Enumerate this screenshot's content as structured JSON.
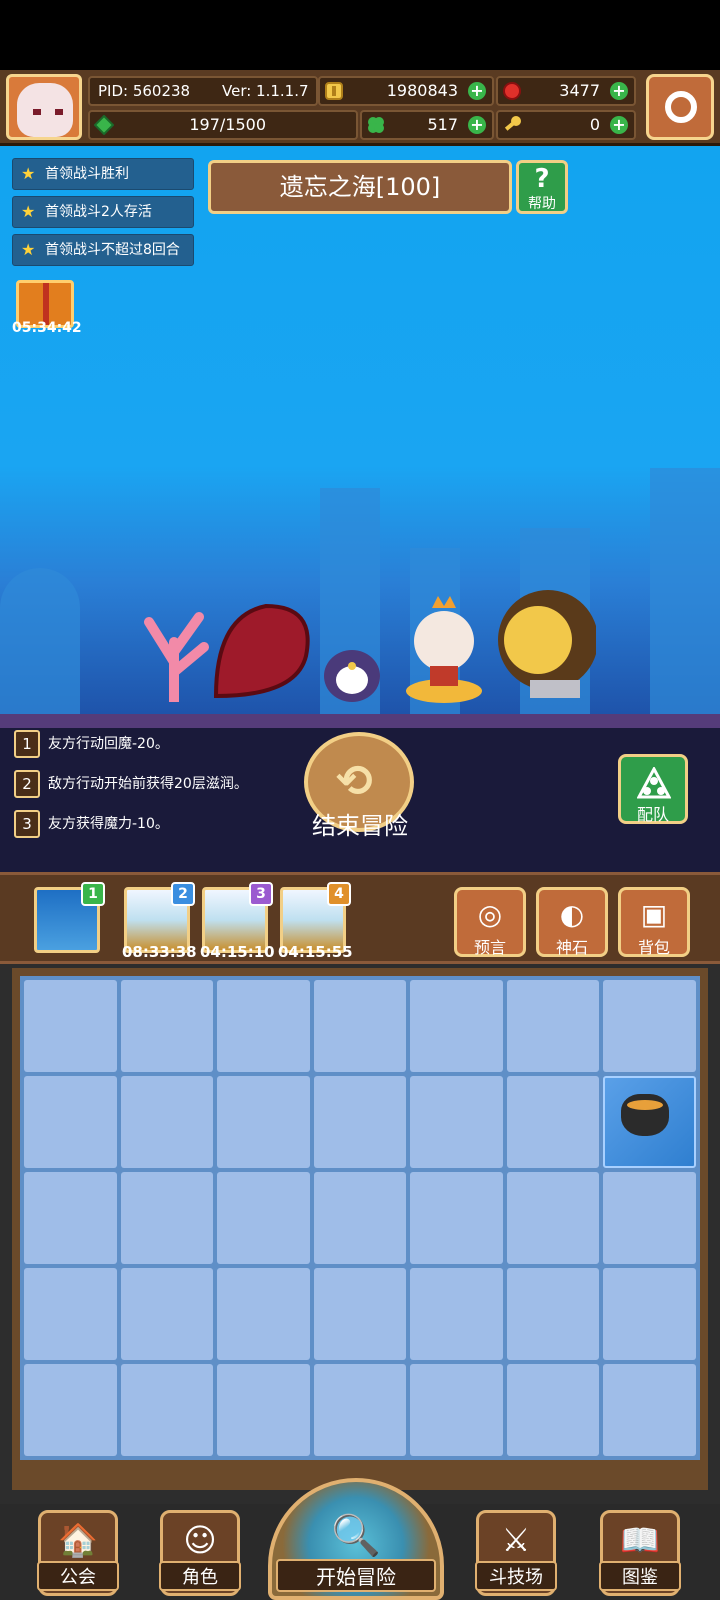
{
  "header": {
    "pid": "PID: 560238",
    "version": "Ver: 1.1.1.7",
    "gold": "1980843",
    "gems": "3477",
    "energy": "197/1500",
    "clover": "517",
    "keys": "0"
  },
  "quests": [
    {
      "label": "首领战斗胜利"
    },
    {
      "label": "首领战斗2人存活"
    },
    {
      "label": "首领战斗不超过8回合"
    }
  ],
  "stage": {
    "title": "遗忘之海[100]",
    "help_label": "帮助"
  },
  "gift": {
    "timer": "05:34:42"
  },
  "effects": [
    {
      "num": "1",
      "text": "友方行动回魔-20。"
    },
    {
      "num": "2",
      "text": "敌方行动开始前获得20层滋润。"
    },
    {
      "num": "3",
      "text": "友方获得魔力-10。"
    }
  ],
  "adventure": {
    "end_label": "结束冒险",
    "team_label": "配队"
  },
  "map_tabs": [
    {
      "badge": "1",
      "badge_color": "#39b54a",
      "timer": ""
    },
    {
      "badge": "2",
      "badge_color": "#3a8ee0",
      "timer": "08:33:38"
    },
    {
      "badge": "3",
      "badge_color": "#9b5ad0",
      "timer": "04:15:10"
    },
    {
      "badge": "4",
      "badge_color": "#e0902a",
      "timer": "04:15:55"
    }
  ],
  "tools": {
    "prophecy": "预言",
    "godstone": "神石",
    "bag": "背包"
  },
  "grid": {
    "rows": 5,
    "cols": 7,
    "item_icon": "cauldron-icon"
  },
  "nav": {
    "guild": "公会",
    "character": "角色",
    "start": "开始冒险",
    "arena": "斗技场",
    "codex": "图鉴"
  },
  "colors": {
    "plus_green": "#39b54a",
    "frame_gold": "#f2cf86",
    "brown": "#5a3a22",
    "sky": "#12a4f0"
  }
}
